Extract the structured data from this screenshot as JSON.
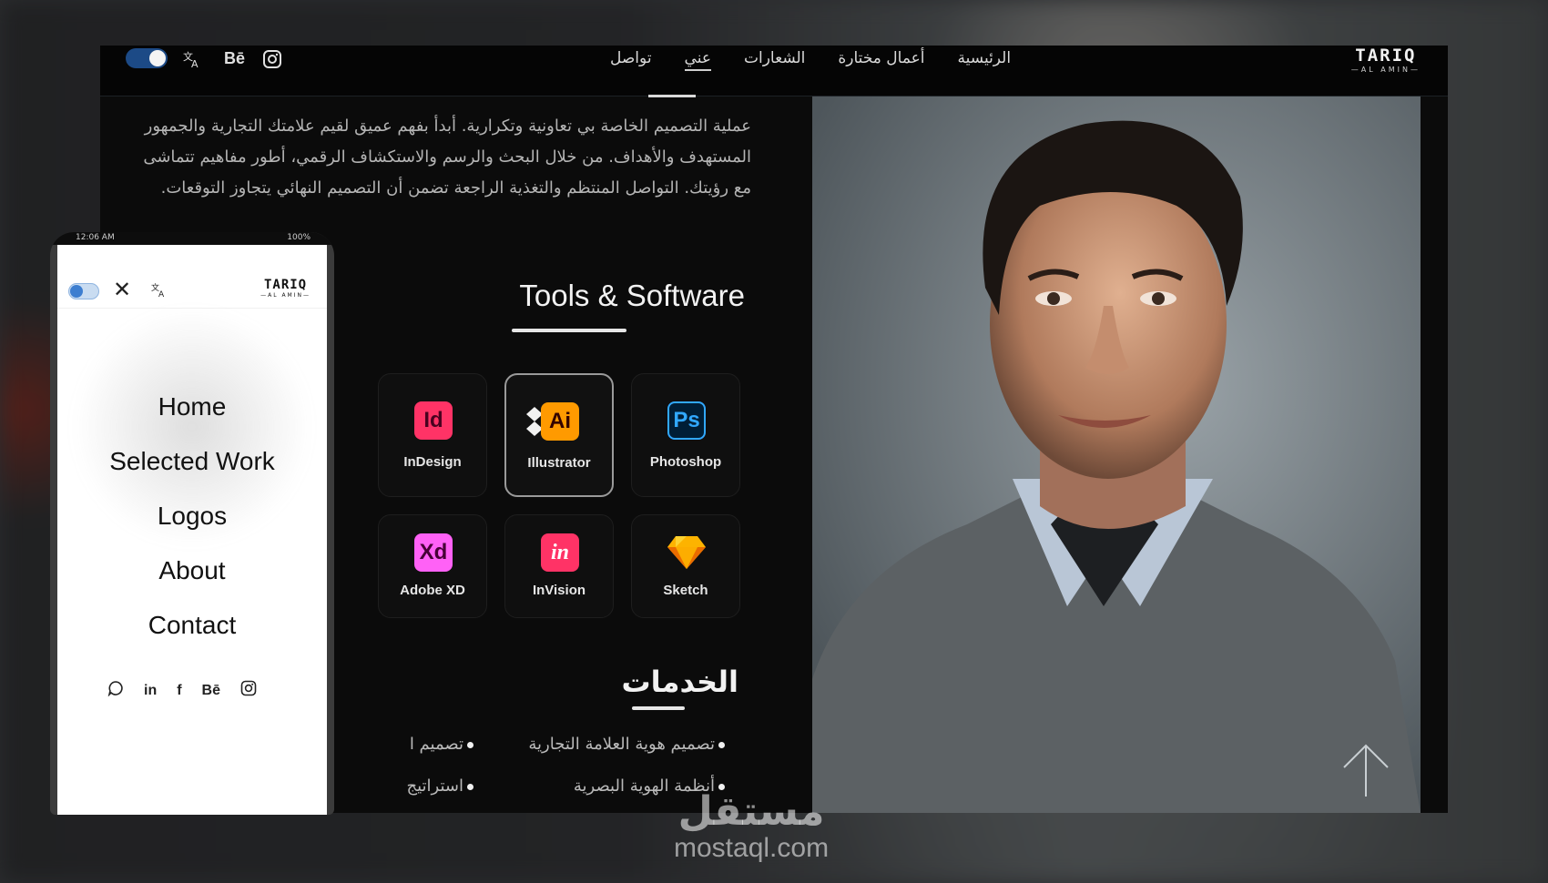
{
  "desktop": {
    "nav": {
      "links": [
        "الرئيسية",
        "أعمال مختارة",
        "الشعارات",
        "عني",
        "تواصل"
      ],
      "active_link": "عني",
      "behance_label": "Bē",
      "logo": {
        "name": "TARIQ",
        "sub": "—AL AMIN—"
      }
    },
    "about_text": "عملية التصميم الخاصة بي تعاونية وتكرارية. أبدأ بفهم عميق لقيم علامتك التجارية والجمهور المستهدف والأهداف. من خلال البحث والرسم والاستكشاف الرقمي، أطور مفاهيم تتماشى مع رؤيتك. التواصل المنتظم والتغذية الراجعة تضمن أن التصميم النهائي يتجاوز التوقعات.",
    "tools": {
      "title": "Tools & Software",
      "items": [
        {
          "short": "Id",
          "name": "InDesign",
          "color": "#ff3366",
          "text_color": "#49021f"
        },
        {
          "short": "Ai",
          "name": "Illustrator",
          "color": "#ff9a00",
          "text_color": "#330000"
        },
        {
          "short": "Ps",
          "name": "Photoshop",
          "color": "#31a8ff",
          "text_color": "#001e36"
        },
        {
          "short": "Xd",
          "name": "Adobe XD",
          "color": "#ff61f6",
          "text_color": "#470137"
        },
        {
          "short": "in",
          "name": "InVision",
          "color": "#ff3366",
          "text_color": "#ffffff"
        },
        {
          "short": "",
          "name": "Sketch",
          "color": "#fdb300",
          "text_color": "#000000"
        }
      ]
    },
    "services": {
      "title": "الخدمات",
      "items": [
        "تصميم هوية العلامة التجارية",
        "تصميم ا",
        "أنظمة الهوية البصرية",
        "استراتيج"
      ]
    }
  },
  "phone": {
    "status": {
      "time": "12:06 AM",
      "battery": "100%"
    },
    "logo": {
      "name": "TARIQ",
      "sub": "—AL AMIN—"
    },
    "menu": [
      "Home",
      "Selected Work",
      "Logos",
      "About",
      "Contact"
    ],
    "social": [
      "whatsapp-icon",
      "linkedin-icon",
      "facebook-icon",
      "behance-icon",
      "instagram-icon"
    ],
    "social_labels": {
      "linkedin": "in",
      "facebook": "f",
      "behance": "Bē"
    }
  },
  "watermark": {
    "arabic": "مستقل",
    "latin": "mostaql.com"
  },
  "colors": {
    "accent_toggle": "#1c4a86",
    "background": "#0b0b0b"
  }
}
